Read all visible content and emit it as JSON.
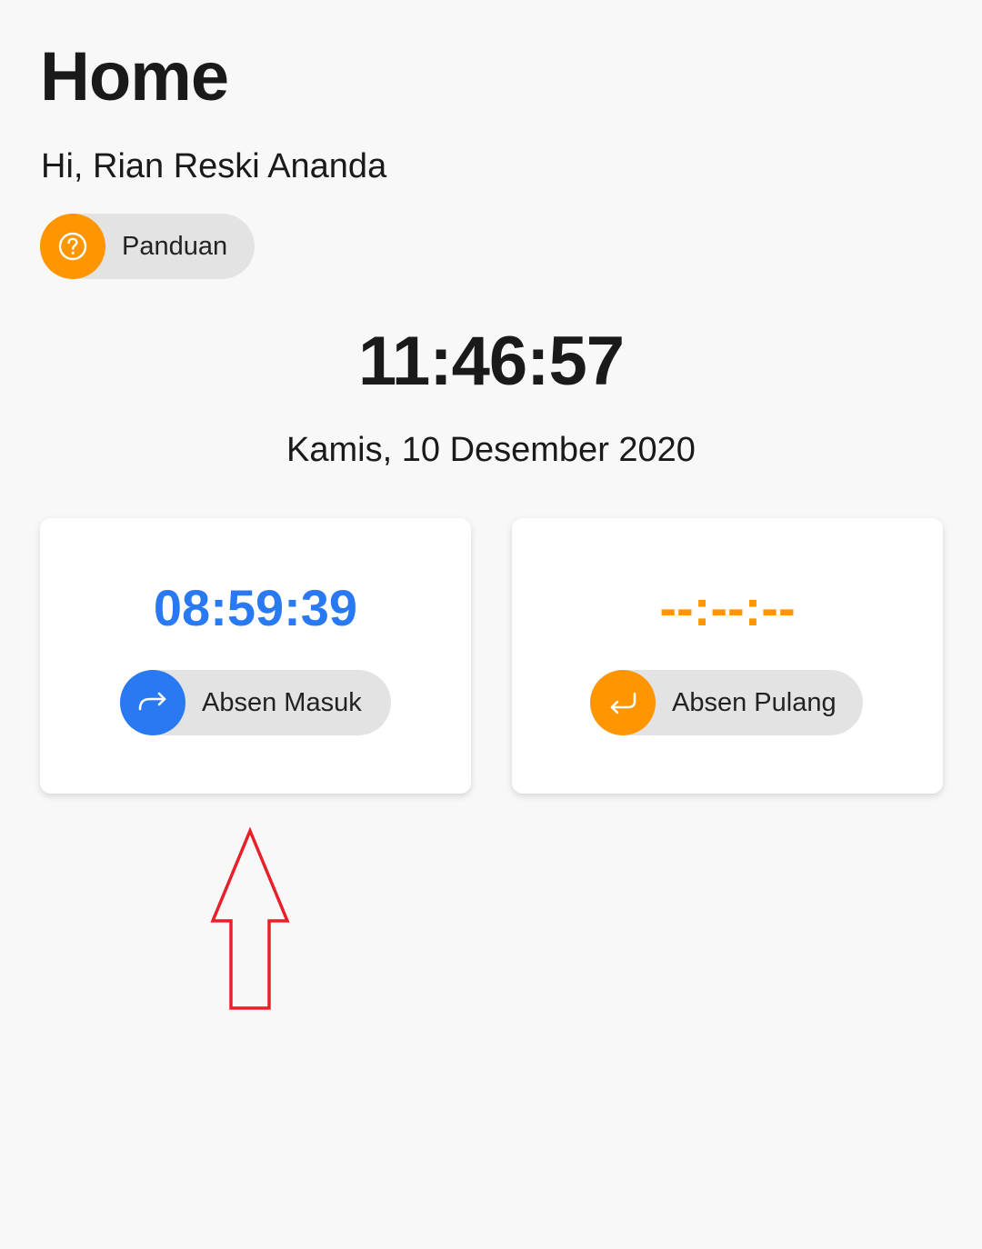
{
  "page": {
    "title": "Home",
    "greeting": "Hi, Rian Reski Ananda"
  },
  "guide_button": {
    "label": "Panduan",
    "icon": "question-circle-icon"
  },
  "clock": {
    "time": "11:46:57",
    "date": "Kamis, 10 Desember 2020"
  },
  "attendance": {
    "check_in": {
      "time": "08:59:39",
      "button_label": "Absen Masuk",
      "icon": "redo-arrow-icon"
    },
    "check_out": {
      "time": "--:--:--",
      "button_label": "Absen Pulang",
      "icon": "return-arrow-icon"
    }
  },
  "colors": {
    "background": "#f8f8f8",
    "accent_blue": "#2979f2",
    "accent_orange": "#ff9500",
    "pill_bg": "#e3e3e3",
    "annotation_red": "#e8202a"
  }
}
